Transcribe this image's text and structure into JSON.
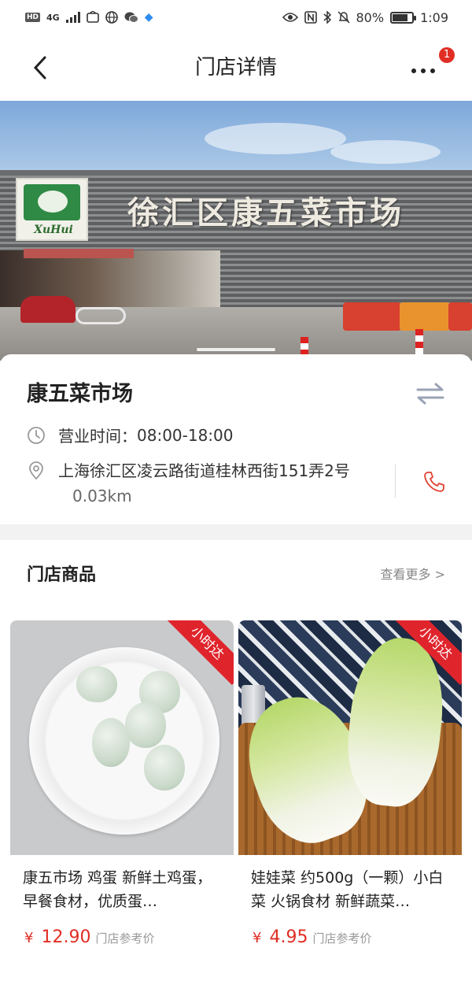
{
  "status_bar": {
    "network": "4G",
    "battery_pct": "80%",
    "battery_level": 0.8,
    "time": "1:09"
  },
  "nav": {
    "title": "门店详情",
    "badge_count": "1"
  },
  "hero": {
    "sign_text": "徐汇区康五菜市场",
    "logo_text": "XuHui"
  },
  "store": {
    "name": "康五菜市场",
    "hours_label": "营业时间：",
    "hours_value": "08:00-18:00",
    "address": "上海徐汇区凌云路街道桂林西街151弄2号",
    "distance": "0.03km"
  },
  "products": {
    "section_title": "门店商品",
    "see_more": "查看更多 >",
    "ribbon_label": "小时达",
    "currency": "¥",
    "items": [
      {
        "name": "康五市场 鸡蛋 新鲜土鸡蛋，早餐食材，优质蛋…",
        "price": "12.90",
        "price_note": "门店参考价"
      },
      {
        "name": "娃娃菜 约500g（一颗）小白菜 火锅食材 新鲜蔬菜…",
        "price": "4.95",
        "price_note": "门店参考价"
      }
    ]
  },
  "colors": {
    "accent_red": "#e02e24",
    "text_primary": "#222222",
    "text_muted": "#888888"
  },
  "icons": [
    "back-icon",
    "more-icon",
    "switch-store-icon",
    "clock-icon",
    "location-icon",
    "phone-icon"
  ]
}
